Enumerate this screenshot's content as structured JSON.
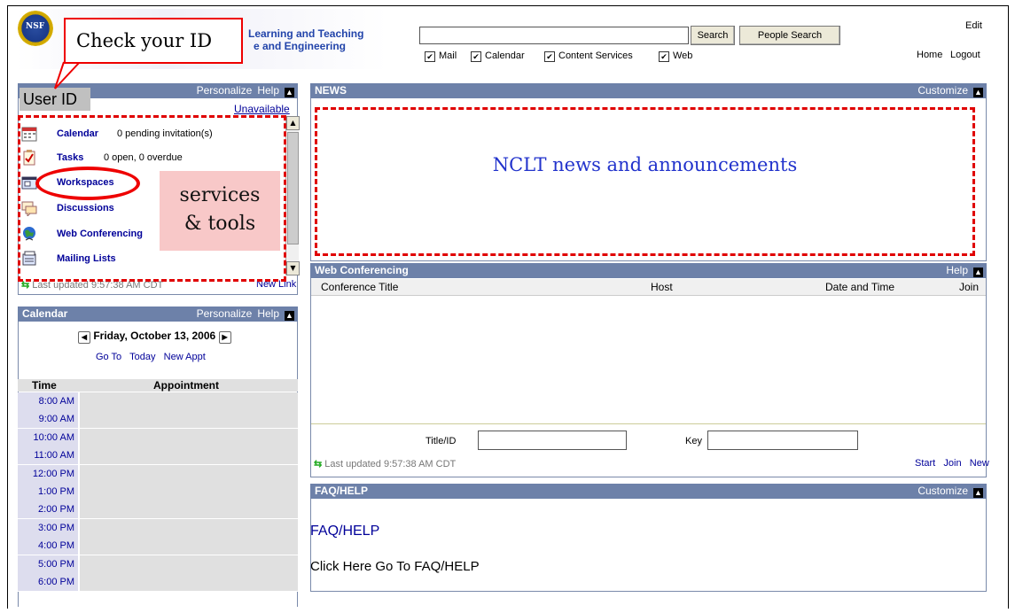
{
  "header": {
    "org_line1": "Learning and Teaching",
    "org_line2": "e and Engineering",
    "nsf_label": "NSF",
    "search_button": "Search",
    "people_search_button": "People Search",
    "checkboxes": [
      {
        "label": "Mail",
        "checked": true
      },
      {
        "label": "Calendar",
        "checked": true
      },
      {
        "label": "Content Services",
        "checked": true
      },
      {
        "label": "Web",
        "checked": true
      }
    ],
    "check_mark": "✔",
    "edit": "Edit",
    "home": "Home",
    "logout": "Logout"
  },
  "annotations": {
    "check_id": "Check your ID",
    "user_id": "User ID",
    "services_tools_1": "services",
    "services_tools_2": "& tools",
    "news_text": "NCLT news and announcements"
  },
  "user_panel": {
    "personalize": "Personalize",
    "help": "Help",
    "status": "Unavailable",
    "services": [
      {
        "name": "Calendar",
        "status": "0 pending invitation(s)"
      },
      {
        "name": "Tasks",
        "status": "0 open, 0 overdue"
      },
      {
        "name": "Workspaces",
        "status": ""
      },
      {
        "name": "Discussions",
        "status": ""
      },
      {
        "name": "Web Conferencing",
        "status": ""
      },
      {
        "name": "Mailing Lists",
        "status": ""
      }
    ],
    "last_updated": "Last updated 9:57:38 AM CDT",
    "new_link": "New Link"
  },
  "calendar": {
    "title": "Calendar",
    "personalize": "Personalize",
    "help": "Help",
    "date": "Friday, October 13, 2006",
    "goto": "Go To",
    "today": "Today",
    "new_appt": "New Appt",
    "col_time": "Time",
    "col_appt": "Appointment",
    "times": [
      "8:00 AM",
      "9:00 AM",
      "10:00 AM",
      "11:00 AM",
      "12:00 PM",
      "1:00 PM",
      "2:00 PM",
      "3:00 PM",
      "4:00 PM",
      "5:00 PM",
      "6:00 PM"
    ]
  },
  "news": {
    "title": "NEWS",
    "customize": "Customize"
  },
  "webconf": {
    "title": "Web Conferencing",
    "help": "Help",
    "col_title": "Conference Title",
    "col_host": "Host",
    "col_date": "Date and Time",
    "col_join": "Join",
    "title_id_label": "Title/ID",
    "key_label": "Key",
    "last_updated": "Last updated 9:57:38 AM CDT",
    "start": "Start",
    "join": "Join",
    "new": "New"
  },
  "faq": {
    "title": "FAQ/HELP",
    "customize": "Customize",
    "heading": "FAQ/HELP",
    "link": "Click Here Go To FAQ/HELP"
  }
}
